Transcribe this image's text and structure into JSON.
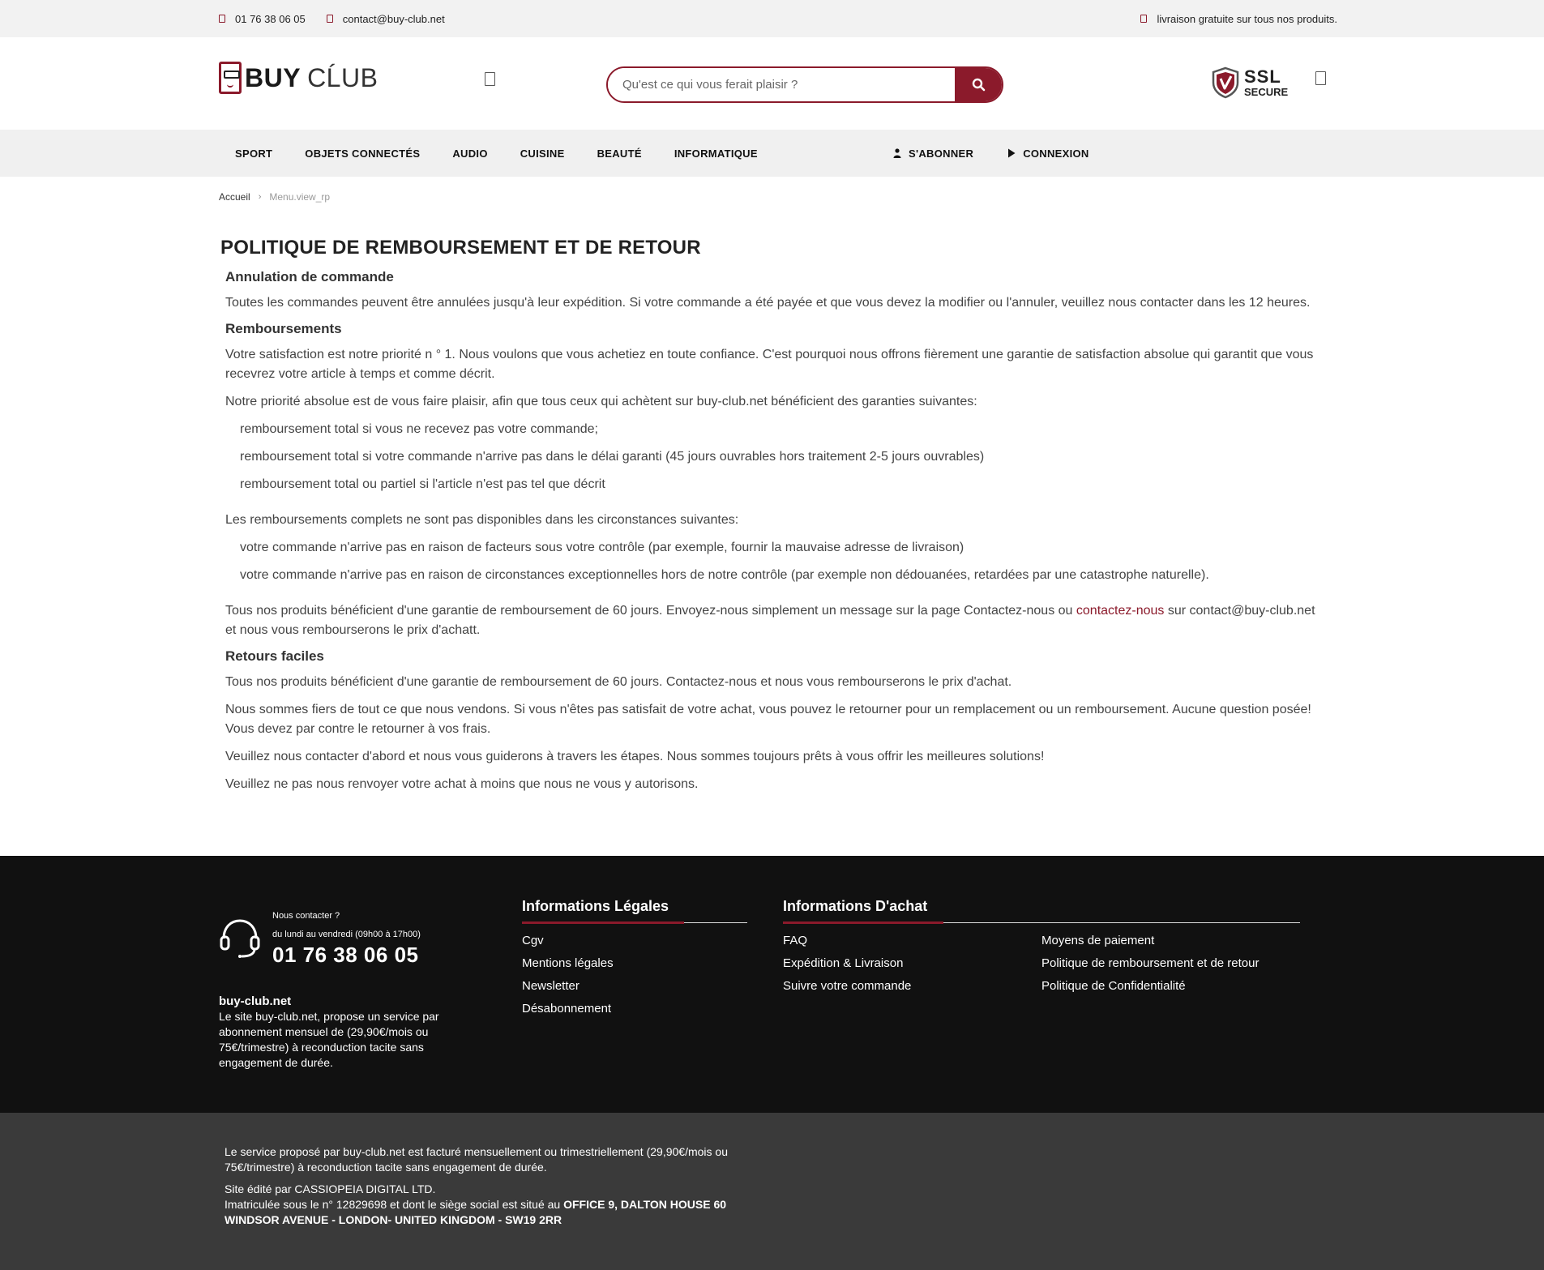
{
  "topbar": {
    "phone": "01 76 38 06 05",
    "email": "contact@buy-club.net",
    "shipping": "livraison gratuite sur tous nos produits."
  },
  "header": {
    "logo_buy": "BUY",
    "logo_club": "CĹUB",
    "search_placeholder": "Qu'est ce qui vous ferait plaisir ?",
    "ssl_big": "SSL",
    "ssl_small": "SECURE"
  },
  "nav": {
    "items": [
      "SPORT",
      "OBJETS CONNECTÉS",
      "AUDIO",
      "CUISINE",
      "BEAUTÉ",
      "INFORMATIQUE"
    ],
    "subscribe": "S'ABONNER",
    "login": "CONNEXION"
  },
  "breadcrumb": {
    "home": "Accueil",
    "current": "Menu.view_rp"
  },
  "content": {
    "title": "POLITIQUE DE REMBOURSEMENT ET DE RETOUR",
    "h_cancel": "Annulation de commande",
    "p_cancel": "Toutes les commandes peuvent être annulées jusqu'à leur expédition. Si votre commande a été payée et que vous devez la modifier ou l'annuler, veuillez nous contacter dans les 12 heures.",
    "h_refund": "Remboursements",
    "p_refund1": "Votre satisfaction est notre priorité n ° 1. Nous voulons que vous achetiez en toute confiance. C'est pourquoi nous offrons fièrement une garantie de satisfaction absolue qui garantit que vous recevrez votre article à temps et comme décrit.",
    "p_refund2": "Notre priorité absolue est de vous faire plaisir, afin que tous ceux qui achètent sur buy-club.net bénéficient des garanties suivantes:",
    "list_guarantees": [
      "remboursement total si vous ne recevez pas votre commande;",
      "remboursement total si votre commande n'arrive pas dans le délai garanti (45 jours ouvrables hors traitement 2-5 jours ouvrables)",
      "remboursement total ou partiel si l'article n'est pas tel que décrit"
    ],
    "p_refund3": "Les remboursements complets ne sont pas disponibles dans les circonstances suivantes:",
    "list_exclusions": [
      "votre commande n'arrive pas en raison de facteurs sous votre contrôle (par exemple, fournir la mauvaise adresse de livraison)",
      "votre commande n'arrive pas en raison de circonstances exceptionnelles hors de notre contrôle (par exemple non dédouanées, retardées par une catastrophe naturelle)."
    ],
    "p_refund4_a": "Tous nos produits bénéficient d'une garantie de remboursement de 60 jours. Envoyez-nous simplement un message sur la page Contactez-nous ou ",
    "p_refund4_link": "contactez-nous",
    "p_refund4_b": " sur contact@buy-club.net et nous vous rembourserons le prix d'achatt.",
    "h_returns": "Retours faciles",
    "p_returns1": "Tous nos produits bénéficient d'une garantie de remboursement de 60 jours. Contactez-nous et nous vous rembourserons le prix d'achat.",
    "p_returns2": "Nous sommes fiers de tout ce que nous vendons. Si vous n'êtes pas satisfait de votre achat, vous pouvez le retourner pour un remplacement ou un remboursement. Aucune question posée! Vous devez par contre le retourner à vos frais.",
    "p_returns3": "Veuillez nous contacter d'abord et nous vous guiderons à travers les étapes. Nous sommes toujours prêts à vous offrir les meilleures solutions!",
    "p_returns4": "Veuillez ne pas nous renvoyer votre achat à moins que nous ne vous y autorisons."
  },
  "footer": {
    "contact_label": "Nous contacter ?",
    "contact_hours": "du lundi au vendredi (09h00 à 17h00)",
    "contact_phone": "01 76 38 06 05",
    "about_brand": "buy-club.net",
    "about_text": "Le site buy-club.net, propose un service par abonnement mensuel de (29,90€/mois ou 75€/trimestre) à reconduction tacite sans engagement de durée.",
    "legal_title": "Informations Légales",
    "legal_links": [
      "Cgv",
      "Mentions légales",
      "Newsletter",
      "Désabonnement"
    ],
    "purchase_title": "Informations D'achat",
    "purchase_links_left": [
      "FAQ",
      "Expédition & Livraison",
      "Suivre votre commande"
    ],
    "purchase_links_right": [
      "Moyens de paiement",
      "Politique de remboursement et de retour",
      "Politique de Confidentialité"
    ]
  },
  "bottombar": {
    "line1": "Le service proposé par buy-club.net est facturé mensuellement ou trimestriellement (29,90€/mois ou 75€/trimestre) à reconduction tacite sans engagement de durée.",
    "line2": "Site édité par CASSIOPEIA DIGITAL LTD.",
    "line3": "Imatriculée sous le n° 12829698 et dont le siège social est situé au ",
    "address": "OFFICE 9, DALTON HOUSE 60 WINDSOR AVENUE - LONDON- UNITED KINGDOM - SW19 2RR"
  },
  "colors": {
    "brand": "#8b1a2b",
    "footer_bg": "#111111",
    "bottombar_bg": "#3a3a3a"
  }
}
